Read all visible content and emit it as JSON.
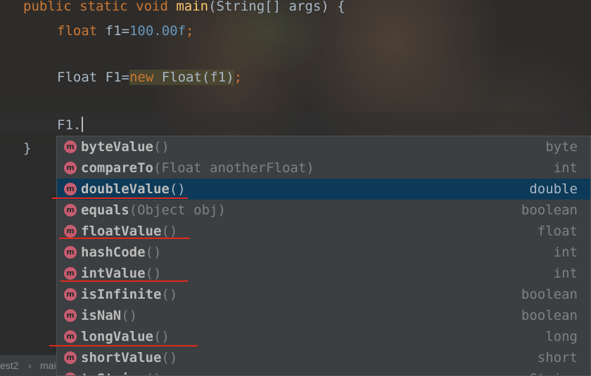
{
  "editor": {
    "lines": {
      "main_sig_mod": "public static void ",
      "main_sig_name": "main",
      "main_sig_rest": "(String[] args) {",
      "f1_type": "float",
      "f1_name": " f1=",
      "f1_value": "100.00f",
      "f1_end": ";",
      "F1_decl": "Float F1=",
      "F1_new": "new",
      "F1_ctor": " Float(f1)",
      "F1_end": ";",
      "typing": "F1.",
      "close_brace": "}"
    }
  },
  "completion": {
    "icon_letter": "m",
    "items": [
      {
        "name": "byteValue",
        "params": "()",
        "type": "byte"
      },
      {
        "name": "compareTo",
        "params": "(Float anotherFloat)",
        "type": "int"
      },
      {
        "name": "doubleValue",
        "params": "()",
        "type": "double"
      },
      {
        "name": "equals",
        "params": "(Object obj)",
        "type": "boolean"
      },
      {
        "name": "floatValue",
        "params": "()",
        "type": "float"
      },
      {
        "name": "hashCode",
        "params": "()",
        "type": "int"
      },
      {
        "name": "intValue",
        "params": "()",
        "type": "int"
      },
      {
        "name": "isInfinite",
        "params": "()",
        "type": "boolean"
      },
      {
        "name": "isNaN",
        "params": "()",
        "type": "boolean"
      },
      {
        "name": "longValue",
        "params": "()",
        "type": "long"
      },
      {
        "name": "shortValue",
        "params": "()",
        "type": "short"
      },
      {
        "name": "toString",
        "params": "()",
        "type": "String"
      }
    ],
    "selected_index": 2
  },
  "breadcrumb": {
    "part1": "est2",
    "separator": "›",
    "part2": "mai"
  },
  "colors": {
    "keyword": "#cc7832",
    "method": "#ffc66d",
    "number": "#6897bb",
    "selection": "#0d3a58",
    "annotation_underline": "#e0291f"
  }
}
